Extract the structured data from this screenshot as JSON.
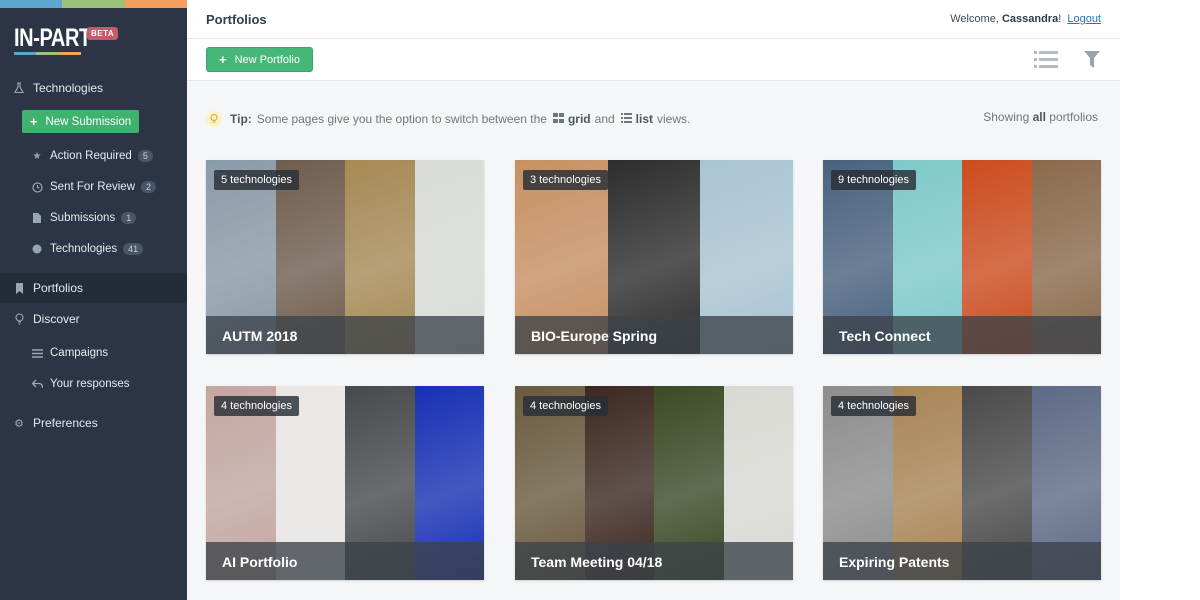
{
  "brand": {
    "logo_text": "IN-PART",
    "beta_label": "BETA",
    "strip_colors": [
      "#5ba7cf",
      "#9cc27a",
      "#f3a15a"
    ],
    "accent_green": "#3fb36e"
  },
  "sidebar": {
    "technologies_label": "Technologies",
    "new_submission_label": "New Submission",
    "sub_items": [
      {
        "label": "Action Required",
        "count": "5"
      },
      {
        "label": "Sent For Review",
        "count": "2"
      },
      {
        "label": "Submissions",
        "count": "1"
      },
      {
        "label": "Technologies",
        "count": "41"
      }
    ],
    "portfolios_label": "Portfolios",
    "discover_label": "Discover",
    "discover_items": [
      {
        "label": "Campaigns"
      },
      {
        "label": "Your responses"
      }
    ],
    "preferences_label": "Preferences"
  },
  "header": {
    "title": "Portfolios",
    "welcome_prefix": "Welcome,",
    "user_name": "Cassandra",
    "welcome_suffix": "!",
    "logout_label": "Logout"
  },
  "toolbar": {
    "new_portfolio_label": "New Portfolio"
  },
  "tip": {
    "label": "Tip:",
    "text_before": "Some pages give you the option to switch between the",
    "grid_word": "grid",
    "and_word": "and",
    "list_word": "list",
    "text_after": "views."
  },
  "showing": {
    "prefix": "Showing",
    "bold": "all",
    "suffix": "portfolios"
  },
  "portfolios": [
    {
      "badge": "5 technologies",
      "title": "AUTM 2018",
      "colors": [
        "#8a9aa8",
        "#6f5d4e",
        "#a68a55",
        "#d7dcd6"
      ]
    },
    {
      "badge": "3 technologies",
      "title": "BIO-Europe Spring",
      "colors": [
        "#c79062",
        "#2d2d2d",
        "#a9c4d3"
      ]
    },
    {
      "badge": "9 technologies",
      "title": "Tech Connect",
      "colors": [
        "#48627e",
        "#7fc9cb",
        "#cc4c1e",
        "#8a6a4c"
      ]
    },
    {
      "badge": "4 technologies",
      "title": "AI Portfolio",
      "colors": [
        "#c4a6a1",
        "#e9e6e4",
        "#47494d",
        "#1830b4"
      ]
    },
    {
      "badge": "4 technologies",
      "title": "Team Meeting 04/18",
      "colors": [
        "#6a5a3e",
        "#3c2820",
        "#3c4a25",
        "#d9d9d4"
      ]
    },
    {
      "badge": "4 technologies",
      "title": "Expiring Patents",
      "colors": [
        "#8d8d8d",
        "#a88555",
        "#4a4a4a",
        "#5e6a86"
      ]
    }
  ]
}
